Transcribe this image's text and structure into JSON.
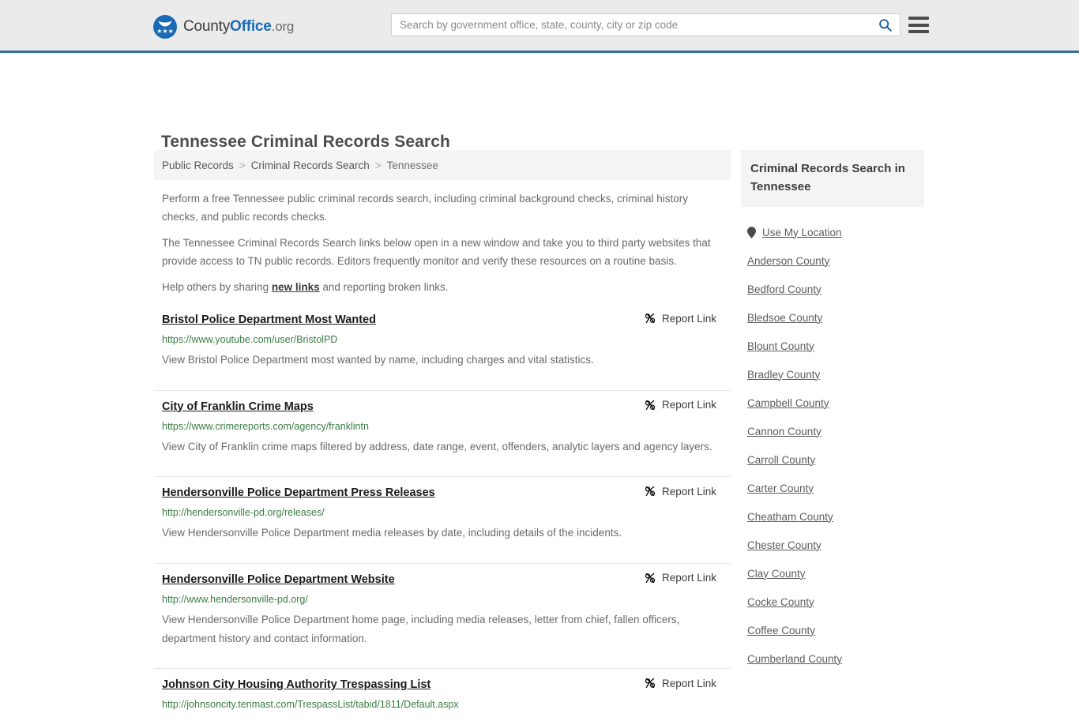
{
  "header": {
    "brand": {
      "part1": "County",
      "part2": "Office",
      "tld": ".org",
      "logo_icon": "eagle-stars-icon"
    },
    "search": {
      "placeholder": "Search by government office, state, county, city or zip code",
      "value": "",
      "search_icon": "search-icon"
    },
    "menu_icon": "hamburger-menu-icon",
    "accent_color": "#336f9e",
    "background_color": "#ebebeb"
  },
  "page": {
    "title": "Tennessee Criminal Records Search"
  },
  "breadcrumb": {
    "items": [
      {
        "label": "Public Records"
      },
      {
        "label": "Criminal Records Search"
      },
      {
        "label": "Tennessee"
      }
    ],
    "separator": ">"
  },
  "intro": {
    "p1": "Perform a free Tennessee public criminal records search, including criminal background checks, criminal history checks, and public records checks.",
    "p2": "The Tennessee Criminal Records Search links below open in a new window and take you to third party websites that provide access to TN public records. Editors frequently monitor and verify these resources on a routine basis.",
    "p3_before": "Help others by sharing ",
    "p3_link": "new links",
    "p3_after": " and reporting broken links."
  },
  "report_link": {
    "label": "Report Link",
    "icon": "broken-link-icon"
  },
  "results": [
    {
      "title": "Bristol Police Department Most Wanted",
      "url": "https://www.youtube.com/user/BristolPD",
      "description": "View Bristol Police Department most wanted by name, including charges and vital statistics."
    },
    {
      "title": "City of Franklin Crime Maps",
      "url": "https://www.crimereports.com/agency/franklintn",
      "description": "View City of Franklin crime maps filtered by address, date range, event, offenders, analytic layers and agency layers."
    },
    {
      "title": "Hendersonville Police Department Press Releases",
      "url": "http://hendersonville-pd.org/releases/",
      "description": "View Hendersonville Police Department media releases by date, including details of the incidents."
    },
    {
      "title": "Hendersonville Police Department Website",
      "url": "http://www.hendersonville-pd.org/",
      "description": "View Hendersonville Police Department home page, including media releases, letter from chief, fallen officers, department history and contact information."
    },
    {
      "title": "Johnson City Housing Authority Trespassing List",
      "url": "http://johnsoncity.tenmast.com/TrespassList/tabid/1811/Default.aspx",
      "description": ""
    }
  ],
  "sidebar": {
    "heading": "Criminal Records Search in Tennessee",
    "use_my_location": {
      "label": "Use My Location",
      "icon": "map-pin-icon"
    },
    "counties": [
      {
        "label": "Anderson County"
      },
      {
        "label": "Bedford County"
      },
      {
        "label": "Bledsoe County"
      },
      {
        "label": "Blount County"
      },
      {
        "label": "Bradley County"
      },
      {
        "label": "Campbell County"
      },
      {
        "label": "Cannon County"
      },
      {
        "label": "Carroll County"
      },
      {
        "label": "Carter County"
      },
      {
        "label": "Cheatham County"
      },
      {
        "label": "Chester County"
      },
      {
        "label": "Clay County"
      },
      {
        "label": "Cocke County"
      },
      {
        "label": "Coffee County"
      },
      {
        "label": "Cumberland County"
      }
    ]
  }
}
